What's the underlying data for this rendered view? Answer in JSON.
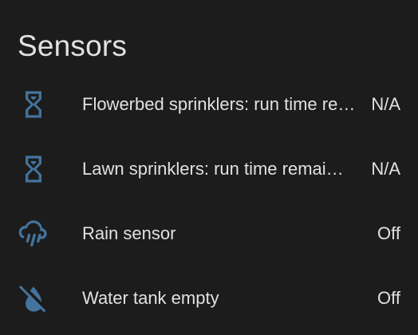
{
  "card": {
    "title": "Sensors"
  },
  "colors": {
    "background": "#1c1c1c",
    "text": "#e1e1e1",
    "icon": "#44739e"
  },
  "rows": [
    {
      "icon": "timer-sand-icon",
      "name": "Flowerbed sprinklers: run time remaining",
      "value": "N/A"
    },
    {
      "icon": "timer-sand-icon",
      "name": "Lawn sprinklers: run time remaining",
      "value": "N/A"
    },
    {
      "icon": "weather-pouring-icon",
      "name": "Rain sensor",
      "value": "Off"
    },
    {
      "icon": "water-off-icon",
      "name": "Water tank empty",
      "value": "Off"
    }
  ]
}
